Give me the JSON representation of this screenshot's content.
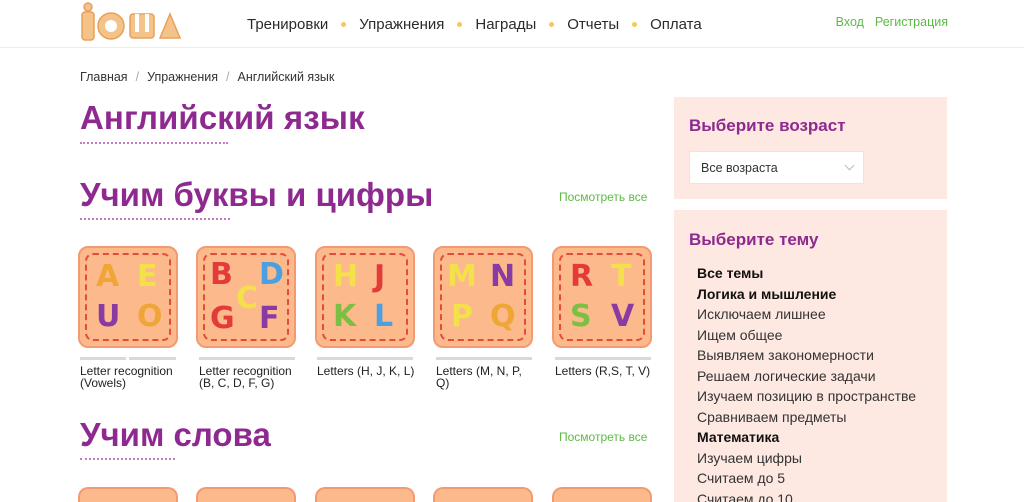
{
  "header": {
    "logo_text": "iQша",
    "nav": [
      "Тренировки",
      "Упражнения",
      "Награды",
      "Отчеты",
      "Оплата"
    ],
    "login": "Вход",
    "register": "Регистрация"
  },
  "breadcrumb": [
    "Главная",
    "Упражнения",
    "Английский язык"
  ],
  "page_title": "Английский язык",
  "sections": [
    {
      "title": "Учим буквы и цифры",
      "see_all": "Посмотреть все",
      "cards": [
        {
          "title": "Letter recognition (Vowels)",
          "letters": [
            "A",
            "E",
            "U",
            "O"
          ]
        },
        {
          "title": "Letter recognition (B, C, D, F, G)",
          "letters": [
            "B",
            "D",
            "C",
            "G",
            "F"
          ]
        },
        {
          "title": "Letters (H, J, K, L)",
          "letters": [
            "H",
            "J",
            "K",
            "L"
          ]
        },
        {
          "title": "Letters (M, N, P, Q)",
          "letters": [
            "M",
            "N",
            "P",
            "Q"
          ]
        },
        {
          "title": "Letters (R,S, T, V)",
          "letters": [
            "R",
            "T",
            "S",
            "V"
          ]
        }
      ]
    },
    {
      "title": "Учим слова",
      "see_all": "Посмотреть все"
    }
  ],
  "sidebar": {
    "age_title": "Выберите возраст",
    "age_select": "Все возраста",
    "topic_title": "Выберите тему",
    "topics": [
      {
        "label": "Все темы",
        "bold": true
      },
      {
        "label": "Логика и мышление",
        "bold": true
      },
      {
        "label": "Исключаем лишнее",
        "bold": false
      },
      {
        "label": "Ищем общее",
        "bold": false
      },
      {
        "label": "Выявляем закономерности",
        "bold": false
      },
      {
        "label": "Решаем логические задачи",
        "bold": false
      },
      {
        "label": "Изучаем позицию в пространстве",
        "bold": false
      },
      {
        "label": "Сравниваем предметы",
        "bold": false
      },
      {
        "label": "Математика",
        "bold": true
      },
      {
        "label": "Изучаем цифры",
        "bold": false
      },
      {
        "label": "Считаем до 5",
        "bold": false
      },
      {
        "label": "Считаем до 10",
        "bold": false
      }
    ]
  },
  "colors": {
    "brand_purple": "#8e2a8f",
    "link_green": "#5bbb46",
    "card_bg": "#fbb98c",
    "sidebar_bg": "#fde8e2"
  }
}
